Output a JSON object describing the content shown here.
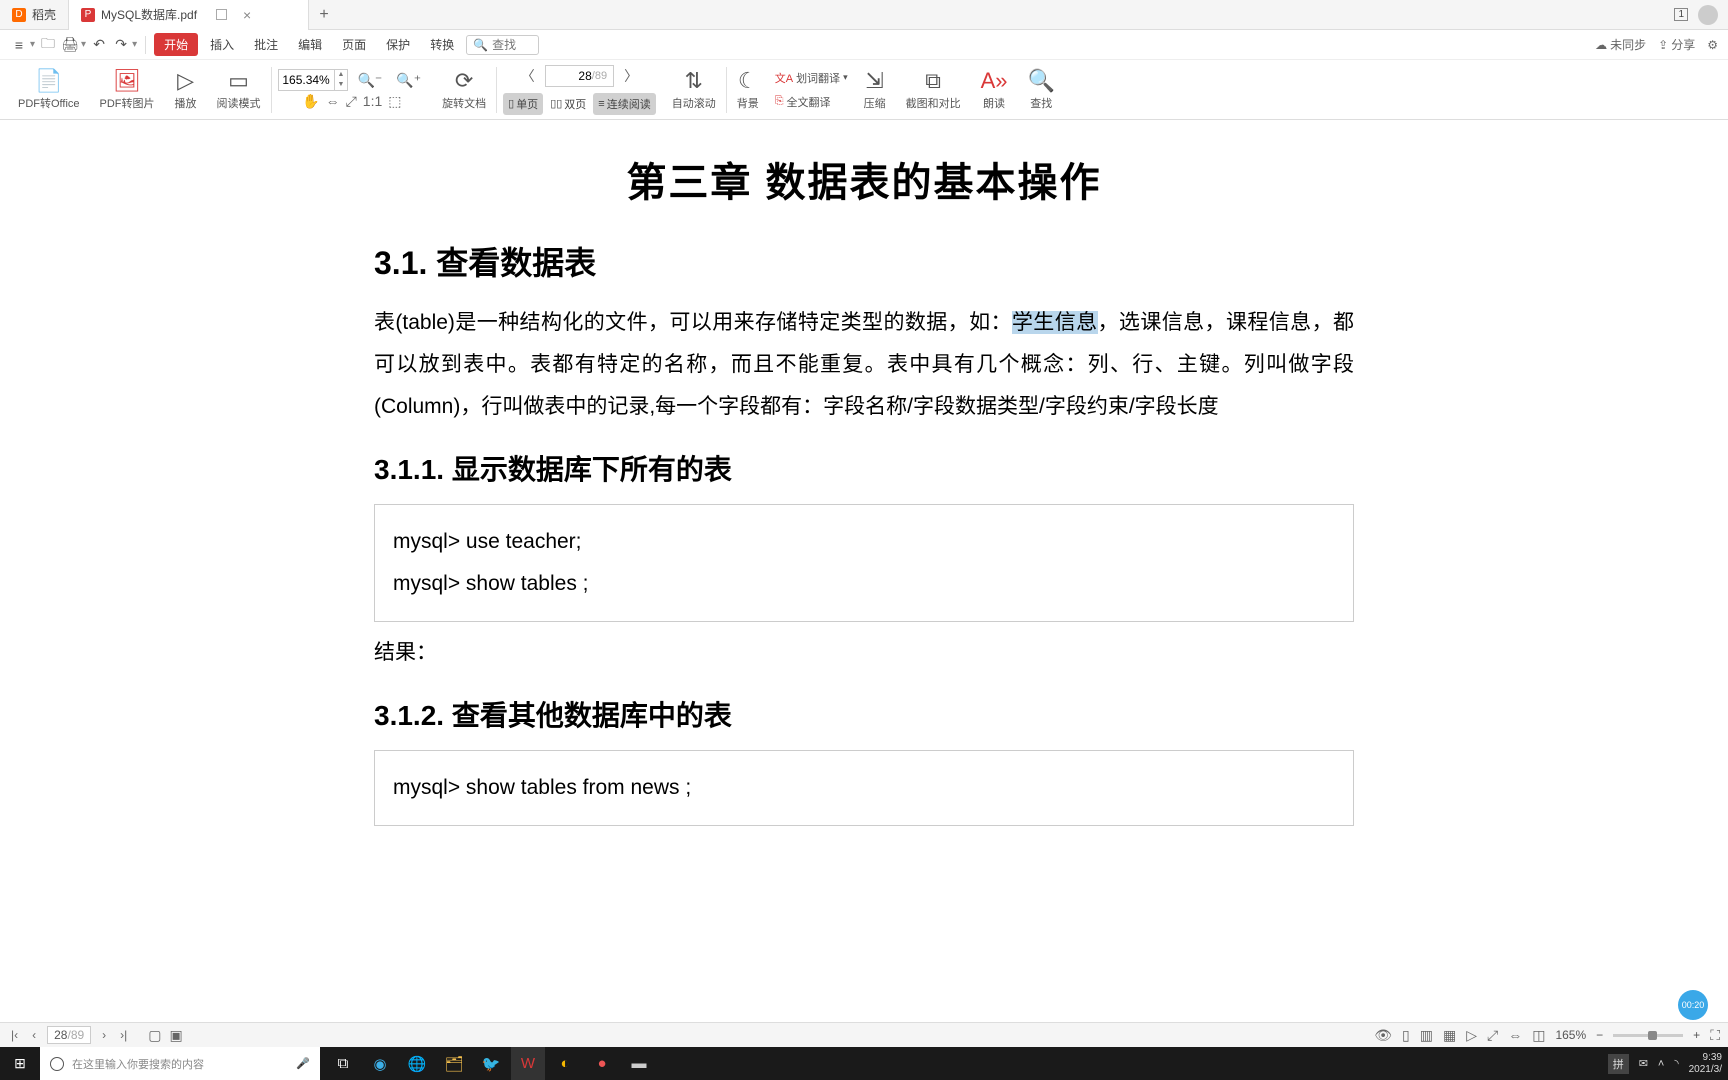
{
  "tabs": {
    "app_tab": "稻壳",
    "file_tab": "MySQL数据库.pdf",
    "add": "+"
  },
  "window": {
    "num": "1"
  },
  "toolbar": {
    "start": "开始",
    "menu": [
      "插入",
      "批注",
      "编辑",
      "页面",
      "保护",
      "转换"
    ],
    "search_placeholder": "查找",
    "sync": "未同步",
    "share": "分享"
  },
  "ribbon": {
    "pdf_office": "PDF转Office",
    "pdf_img": "PDF转图片",
    "play": "播放",
    "read_mode": "阅读模式",
    "zoom": "165.34%",
    "rotate": "旋转文档",
    "cur_page": "28",
    "total_page": "/89",
    "single": "单页",
    "double": "双页",
    "continuous": "连续阅读",
    "auto_scroll": "自动滚动",
    "bg": "背景",
    "word_trans": "划词翻译",
    "full_trans": "全文翻译",
    "compress": "压缩",
    "screenshot": "截图和对比",
    "read_aloud": "朗读",
    "find": "查找"
  },
  "doc": {
    "title": "第三章  数据表的基本操作",
    "h2_1": "3.1. 查看数据表",
    "p1a": "表(table)是一种结构化的文件，可以用来存储特定类型的数据，如：",
    "p1_hl": "学生信息",
    "p1b": "，选课信息，课程信息，都可以放到表中。表都有特定的名称，而且不能重复。表中具有几个概念：列、行、主键。列叫做字段(Column)，行叫做表中的记录,每一个字段都有：字段名称/字段数据类型/字段约束/字段长度",
    "h3_1": "3.1.1.   显示数据库下所有的表",
    "code1_l1": "mysql> use teacher;",
    "code1_l2": "mysql> show tables ;",
    "result": "结果：",
    "h3_2": "3.1.2.   查看其他数据库中的表",
    "code2_l1": "mysql> show tables from news ;"
  },
  "status": {
    "page_cur": "28",
    "page_total": "/89",
    "zoom": "165%"
  },
  "float_timer": "00:20",
  "taskbar": {
    "search": "在这里输入你要搜索的内容",
    "ime": "拼",
    "time": "9:39",
    "date": "2021/3/"
  }
}
